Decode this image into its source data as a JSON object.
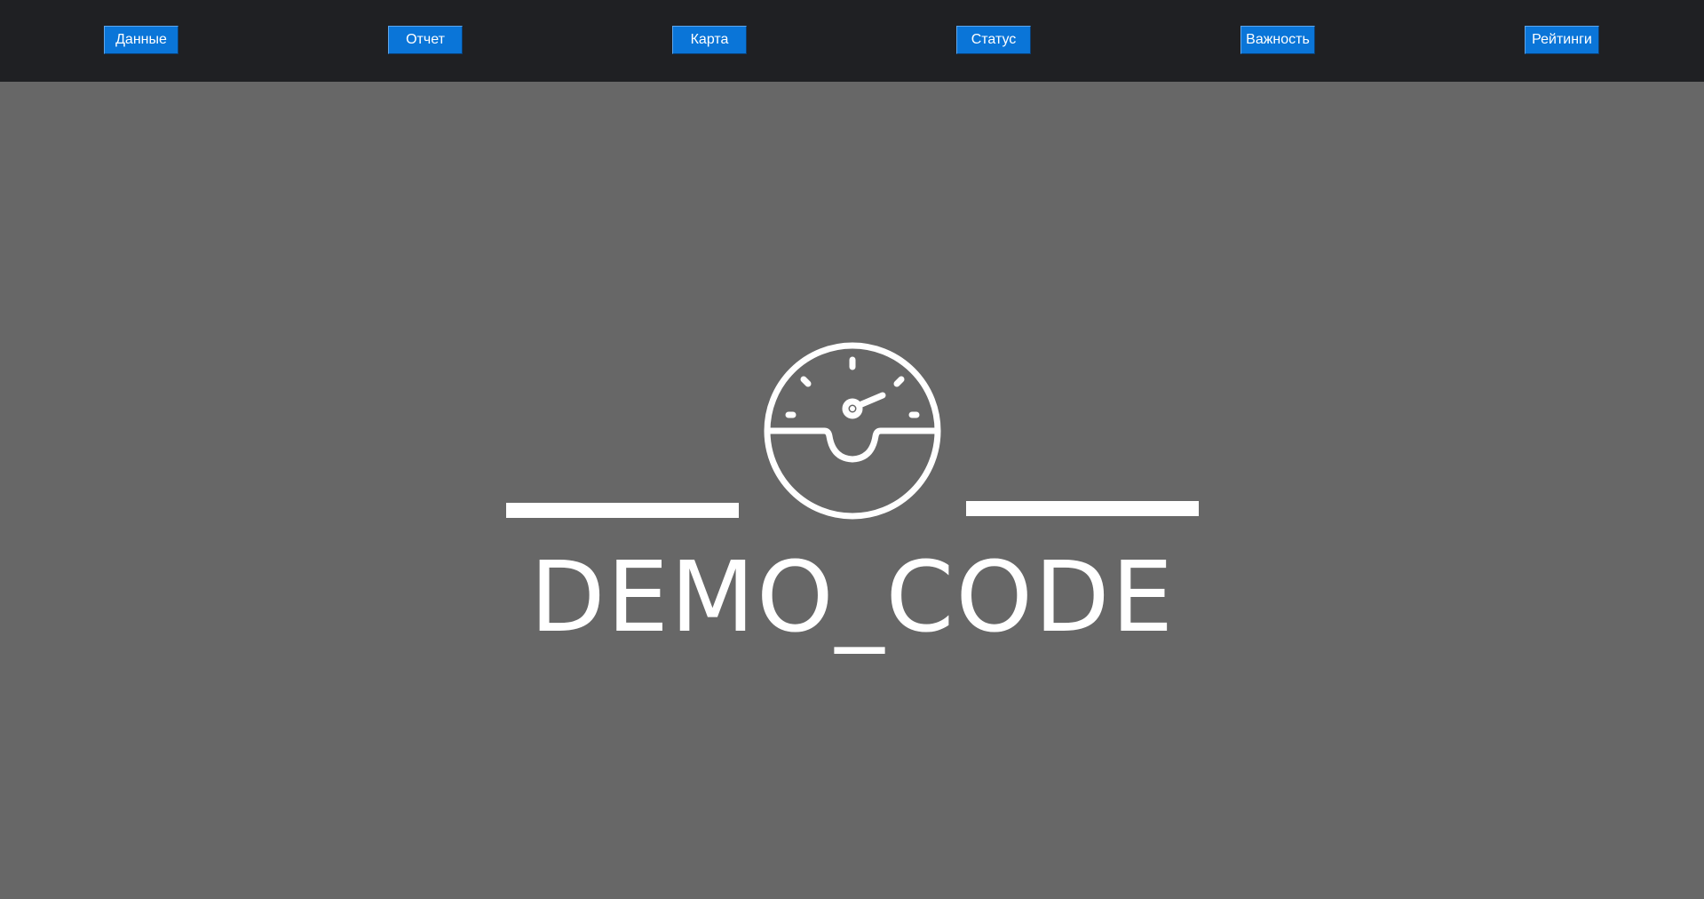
{
  "nav": {
    "items": [
      {
        "label": "Данные"
      },
      {
        "label": "Отчет"
      },
      {
        "label": "Карта"
      },
      {
        "label": "Статус"
      },
      {
        "label": "Важность"
      },
      {
        "label": "Рейтинги"
      }
    ]
  },
  "logo": {
    "icon": "gauge-icon",
    "text": "DEMO_CODE"
  },
  "colors": {
    "topbar": "#1f2023",
    "background": "#676767",
    "button": "#0a75d8",
    "logo": "#ffffff"
  }
}
